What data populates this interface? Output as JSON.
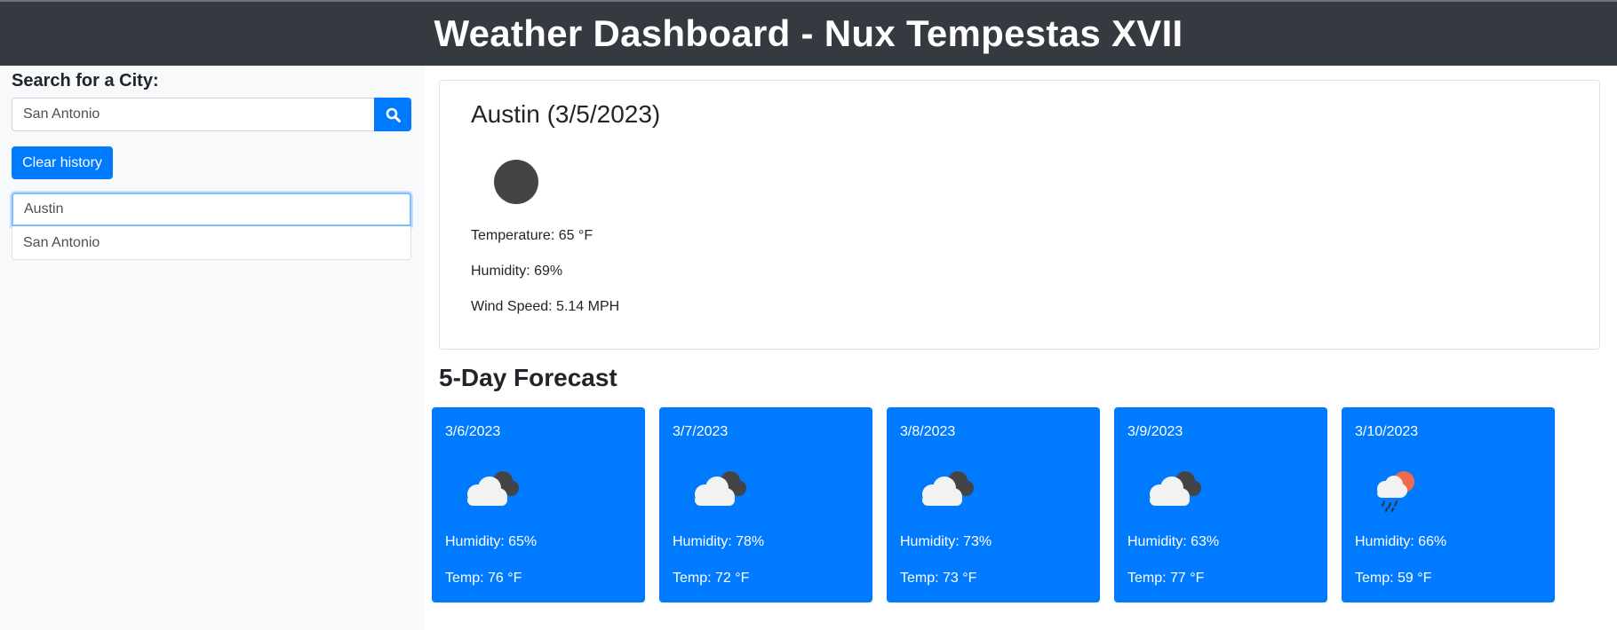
{
  "header": {
    "title": "Weather Dashboard - Nux Tempestas XVII"
  },
  "sidebar": {
    "search_label": "Search for a City:",
    "search_value": "San Antonio",
    "search_icon": "search-icon",
    "clear_label": "Clear history",
    "history": [
      {
        "label": "Austin",
        "active": true
      },
      {
        "label": "San Antonio",
        "active": false
      }
    ]
  },
  "current": {
    "title": "Austin (3/5/2023)",
    "icon": "clear-night-icon",
    "temperature": "Temperature: 65 °F",
    "humidity": "Humidity: 69%",
    "wind": "Wind Speed: 5.14 MPH"
  },
  "forecast": {
    "title": "5-Day Forecast",
    "days": [
      {
        "date": "3/6/2023",
        "icon": "cloudy-icon",
        "humidity": "Humidity: 65%",
        "temp": "Temp: 76 °F"
      },
      {
        "date": "3/7/2023",
        "icon": "cloudy-icon",
        "humidity": "Humidity: 78%",
        "temp": "Temp: 72 °F"
      },
      {
        "date": "3/8/2023",
        "icon": "cloudy-icon",
        "humidity": "Humidity: 73%",
        "temp": "Temp: 73 °F"
      },
      {
        "date": "3/9/2023",
        "icon": "cloudy-icon",
        "humidity": "Humidity: 63%",
        "temp": "Temp: 77 °F"
      },
      {
        "date": "3/10/2023",
        "icon": "rain-sun-icon",
        "humidity": "Humidity: 66%",
        "temp": "Temp: 59 °F"
      }
    ]
  },
  "colors": {
    "header_bg": "#343a40",
    "primary": "#007bff",
    "sidebar_bg": "#f8f9fa"
  }
}
